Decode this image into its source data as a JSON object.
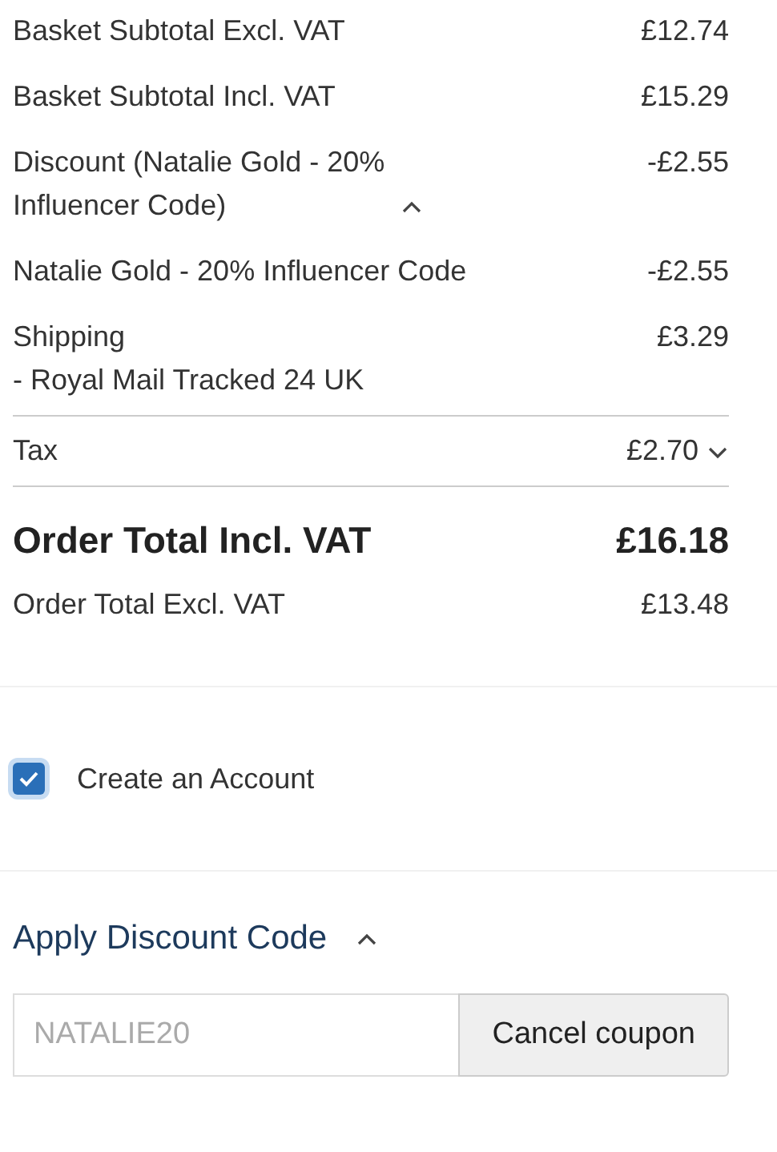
{
  "summary_rows": [
    {
      "kind": "line",
      "label": "Basket Subtotal Excl. VAT",
      "value": "£12.74"
    },
    {
      "kind": "line",
      "label": "Basket Subtotal Incl. VAT",
      "value": "£15.29"
    },
    {
      "kind": "expandable",
      "label": "Discount (Natalie Gold - 20% Influencer Code)",
      "expanded": true,
      "value": "-£2.55"
    },
    {
      "kind": "line",
      "label": "Natalie Gold - 20% Influencer Code",
      "value": "-£2.55"
    },
    {
      "kind": "shipping",
      "label": "Shipping",
      "detail": "- Royal Mail Tracked 24 UK",
      "value": "£3.29"
    }
  ],
  "tax": {
    "label": "Tax",
    "value": "£2.70",
    "expanded": false
  },
  "order_total": {
    "label": "Order Total Incl. VAT",
    "value": "£16.18"
  },
  "order_total_excl": {
    "label": "Order Total Excl. VAT",
    "value": "£13.48"
  },
  "create_account": {
    "label": "Create an Account",
    "checked": true
  },
  "discount": {
    "title": "Apply Discount Code",
    "expanded": true,
    "code": "NATALIE20",
    "disabled": true,
    "button": "Cancel coupon"
  }
}
